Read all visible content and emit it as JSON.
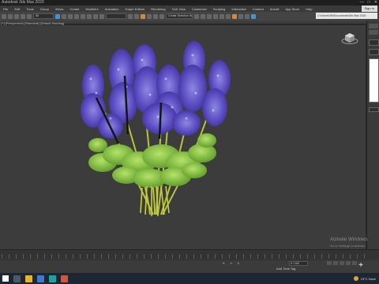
{
  "window": {
    "title": "Autodesk 3ds Max 2020"
  },
  "menu": [
    "File",
    "Edit",
    "Tools",
    "Group",
    "Views",
    "Create",
    "Modifiers",
    "Animation",
    "Graph Editors",
    "Rendering",
    "Civil View",
    "Customize",
    "Scripting",
    "Interactive",
    "Content",
    "Arnold",
    "App Store",
    "Help"
  ],
  "account": {
    "signin_label": "Sign In"
  },
  "toolbar": {
    "selection_filter": "All",
    "selection_set": "Create Selection Se",
    "project_path": "C:\\Users\\VM\\Documents\\3ds Max 2020"
  },
  "viewport": {
    "label": "[+] [Perspective] [Standard] [Default Shading]"
  },
  "statusbar": {
    "add_time_tag": "Add Time Tag",
    "coords": {
      "x": "X:",
      "y": "Y:",
      "z": "Z:"
    },
    "frame": "0 / 100",
    "auto_key": "Auto Key",
    "set_key": "Set Key"
  },
  "watermark": {
    "title": "Activate Windows",
    "subtitle": "Go to Settings to activate Windows."
  },
  "taskbar": {
    "weather": "15°C  Haze",
    "icons": [
      "start-icon",
      "search-icon",
      "file-explorer-icon",
      "store-icon",
      "3dsmax-icon",
      "powerpoint-icon"
    ]
  },
  "colors": {
    "flower": "#5b4bc2",
    "leaf": "#7fc03a",
    "stem": "#c8cf3a",
    "viewport_bg": "#3c3c3c"
  }
}
